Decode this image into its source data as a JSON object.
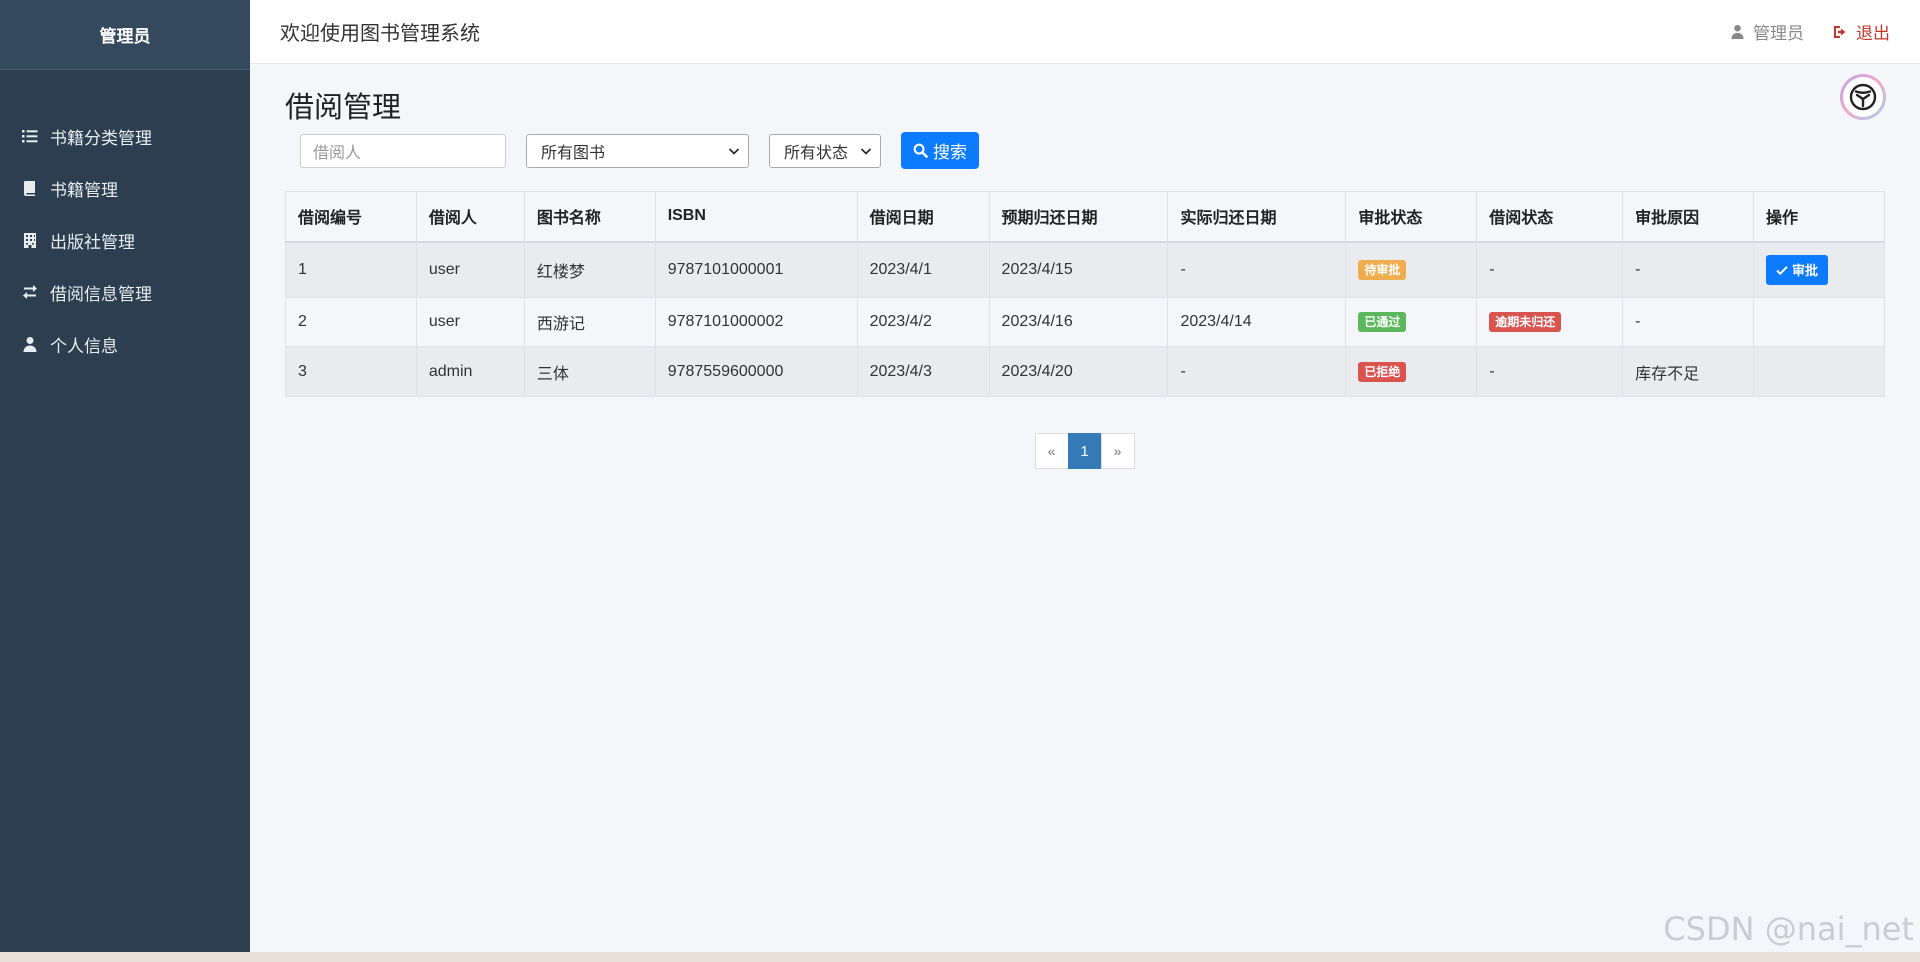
{
  "sidebar": {
    "title": "管理员",
    "items": [
      {
        "label": "书籍分类管理",
        "icon": "list-icon"
      },
      {
        "label": "书籍管理",
        "icon": "book-icon"
      },
      {
        "label": "出版社管理",
        "icon": "building-icon"
      },
      {
        "label": "借阅信息管理",
        "icon": "exchange-icon"
      },
      {
        "label": "个人信息",
        "icon": "user-icon"
      }
    ]
  },
  "header": {
    "title": "欢迎使用图书管理系统",
    "user_label": "管理员",
    "logout_label": "退出"
  },
  "main": {
    "page_title": "借阅管理",
    "search": {
      "borrower_placeholder": "借阅人",
      "book_select": "所有图书",
      "status_select": "所有状态",
      "search_label": "搜索"
    },
    "table": {
      "headers": [
        "借阅编号",
        "借阅人",
        "图书名称",
        "ISBN",
        "借阅日期",
        "预期归还日期",
        "实际归还日期",
        "审批状态",
        "借阅状态",
        "审批原因",
        "操作"
      ],
      "rows": [
        {
          "id": "1",
          "borrower": "user",
          "book": "红楼梦",
          "isbn": "9787101000001",
          "borrow_date": "2023/4/1",
          "due_date": "2023/4/15",
          "return_date": "-",
          "approval": "待审批",
          "borrow_status": "-",
          "reason": "-",
          "action": "审批"
        },
        {
          "id": "2",
          "borrower": "user",
          "book": "西游记",
          "isbn": "9787101000002",
          "borrow_date": "2023/4/2",
          "due_date": "2023/4/16",
          "return_date": "2023/4/14",
          "approval": "已通过",
          "borrow_status": "逾期未归还",
          "reason": "-",
          "action": ""
        },
        {
          "id": "3",
          "borrower": "admin",
          "book": "三体",
          "isbn": "9787559600000",
          "borrow_date": "2023/4/3",
          "due_date": "2023/4/20",
          "return_date": "-",
          "approval": "已拒绝",
          "borrow_status": "-",
          "reason": "库存不足",
          "action": ""
        }
      ]
    },
    "pagination": {
      "prev": "«",
      "current": "1",
      "next": "»"
    }
  },
  "colors": {
    "sidebar_bg": "#2c3e50",
    "primary": "#0d7bff",
    "pending": "#f0ad4e",
    "approved": "#5cb85c",
    "rejected": "#d9534f",
    "logout": "#c0392b"
  },
  "watermark": "CSDN @nai_net"
}
